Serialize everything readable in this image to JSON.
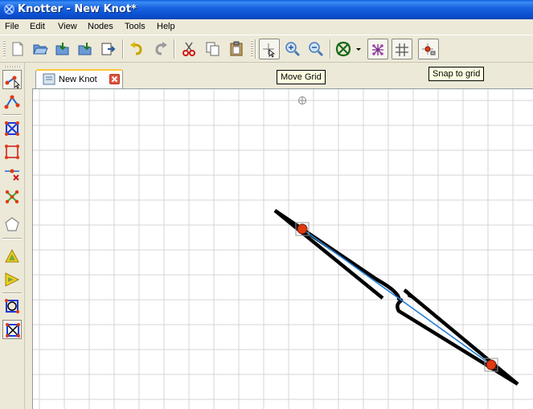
{
  "window": {
    "title": "Knotter - New Knot*",
    "app_icon": "knotter-app-icon"
  },
  "menubar": {
    "items": [
      "File",
      "Edit",
      "View",
      "Nodes",
      "Tools",
      "Help"
    ]
  },
  "toolbar": {
    "buttons": [
      {
        "name": "new-document-icon"
      },
      {
        "name": "open-folder-icon"
      },
      {
        "name": "save-icon"
      },
      {
        "name": "save-as-icon"
      },
      {
        "name": "export-icon"
      },
      {
        "name": "undo-icon"
      },
      {
        "name": "redo-icon"
      },
      {
        "name": "cut-icon"
      },
      {
        "name": "copy-icon"
      },
      {
        "name": "paste-icon"
      },
      {
        "name": "move-grid-icon"
      },
      {
        "name": "zoom-in-icon"
      },
      {
        "name": "zoom-out-icon"
      },
      {
        "name": "knot-style-icon"
      },
      {
        "name": "knot-style-dropdown-icon"
      },
      {
        "name": "display-graph-icon"
      },
      {
        "name": "grid-icon"
      },
      {
        "name": "snap-to-grid-icon"
      }
    ]
  },
  "tooltips": {
    "move_grid": "Move Grid",
    "snap_to_grid": "Snap to grid"
  },
  "tabs": [
    {
      "label": "New Knot",
      "close": "close-tab-icon"
    }
  ],
  "colors": {
    "accent_title": "#0a4fd0",
    "knot_stroke": "#000000",
    "edge_line": "#2280d8",
    "node_fill": "#e03a10",
    "grid": "#d4d4d4",
    "tab_highlight": "#ffc83c"
  }
}
